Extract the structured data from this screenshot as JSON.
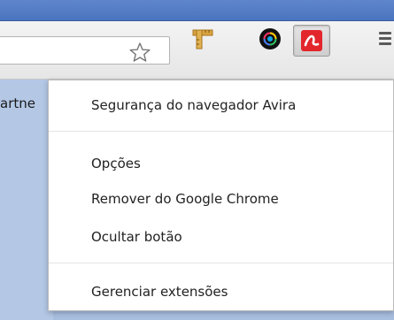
{
  "toolbar": {
    "bookmark_partial": "artne",
    "icons": [
      "star-outline-icon",
      "ruler-icon",
      "color-ball-icon",
      "avira-umbrella-icon",
      "hamburger-menu-icon"
    ],
    "avira_color": "#e2262c"
  },
  "menu": {
    "header": "Segurança do navegador Avira",
    "items": [
      {
        "label": "Opções"
      },
      {
        "label": "Remover do Google Chrome"
      },
      {
        "label": "Ocultar botão"
      }
    ],
    "footer": "Gerenciar extensões"
  }
}
